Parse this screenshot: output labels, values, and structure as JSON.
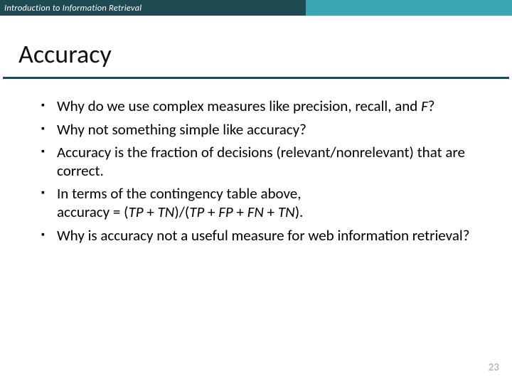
{
  "header": {
    "course": "Introduction to Information Retrieval"
  },
  "title": "Accuracy",
  "bullets": {
    "b0_a": "Why do we use complex measures like precision, recall, and ",
    "b0_b": "F",
    "b0_c": "?",
    "b1": "Why not something simple like accuracy?",
    "b2": "Accuracy is the fraction of decisions (relevant/nonrelevant) that are correct.",
    "b3_a": "In terms of the contingency table above,",
    "b3_b_pre": "accuracy = (",
    "b3_b_tp": "TP",
    "b3_b_plus1": " + ",
    "b3_b_tn": "TN",
    "b3_b_mid": ")/(",
    "b3_b_tp2": "TP",
    "b3_b_plus2": " + ",
    "b3_b_fp": "FP",
    "b3_b_plus3": " + ",
    "b3_b_fn": "FN",
    "b3_b_plus4": " + ",
    "b3_b_tn2": "TN",
    "b3_b_end": ").",
    "b4": "Why is accuracy not a useful measure for web information retrieval?"
  },
  "page": "23"
}
